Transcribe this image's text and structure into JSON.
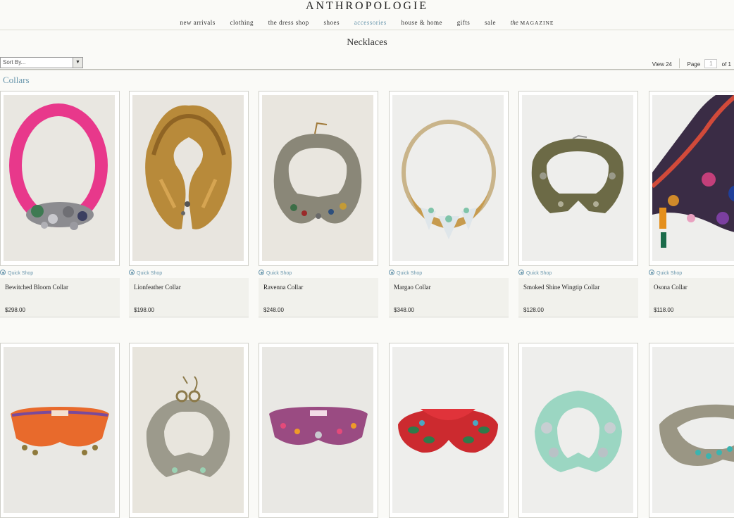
{
  "brand": "ANTHROPOLOGIE",
  "nav": {
    "items": [
      "new arrivals",
      "clothing",
      "the dress shop",
      "shoes",
      "accessories",
      "house & home",
      "gifts",
      "sale"
    ],
    "active": "accessories",
    "magazine_prefix": "the",
    "magazine_word": "MAGAZINE"
  },
  "page_title": "Necklaces",
  "sort": {
    "label": "Sort By..."
  },
  "view": {
    "view_label": "View 24",
    "page_label": "Page",
    "page_value": "1",
    "of_label": "of",
    "total_pages": "1"
  },
  "section_title": "Collars",
  "quick_shop_label": "Quick Shop",
  "products": [
    {
      "name": "Bewitched Bloom Collar",
      "price": "$298.00"
    },
    {
      "name": "Lionfeather Collar",
      "price": "$198.00"
    },
    {
      "name": "Ravenna Collar",
      "price": "$248.00"
    },
    {
      "name": "Margao Collar",
      "price": "$348.00"
    },
    {
      "name": "Smoked Shine Wingtip Collar",
      "price": "$128.00"
    },
    {
      "name": "Osona Collar",
      "price": "$118.00"
    },
    {
      "name": "",
      "price": ""
    },
    {
      "name": "",
      "price": ""
    },
    {
      "name": "",
      "price": ""
    },
    {
      "name": "",
      "price": ""
    },
    {
      "name": "",
      "price": ""
    },
    {
      "name": "",
      "price": ""
    }
  ],
  "colors": {
    "accent": "#6a97ad",
    "page_bg": "#fafaf7",
    "info_bg": "#f1f1ec"
  }
}
